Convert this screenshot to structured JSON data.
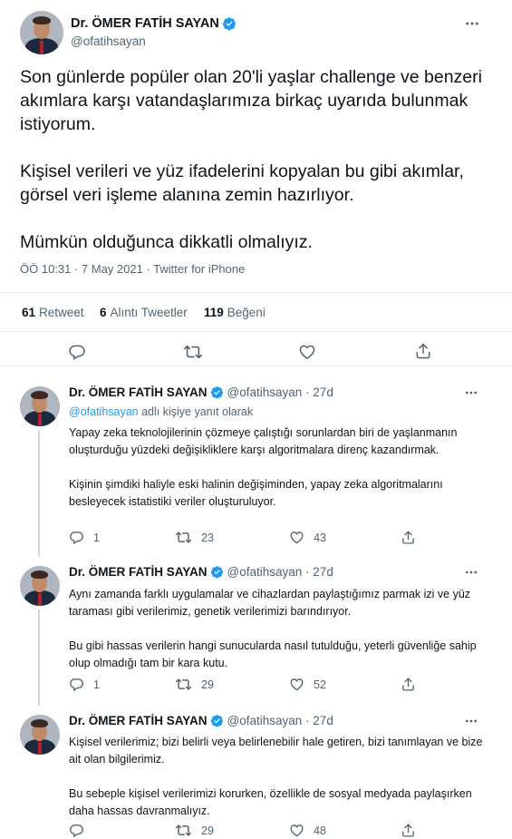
{
  "main_tweet": {
    "author_name": "Dr. ÖMER FATİH SAYAN",
    "author_handle": "@ofatihsayan",
    "paragraphs": [
      "Son günlerde popüler olan 20'li yaşlar challenge ve benzeri akımlara karşı vatandaşlarımıza birkaç uyarıda bulunmak istiyorum.",
      "Kişisel verileri ve yüz ifadelerini kopyalan bu gibi akımlar, görsel veri işleme alanına zemin hazırlıyor.",
      "Mümkün olduğunca dikkatli olmalıyız."
    ],
    "meta": "ÖÖ 10:31 · 7 May 2021 · Twitter for iPhone",
    "stats": {
      "retweets_count": "61",
      "retweets_label": "Retweet",
      "quotes_count": "6",
      "quotes_label": "Alıntı Tweetler",
      "likes_count": "119",
      "likes_label": "Beğeni"
    }
  },
  "replies": [
    {
      "author_name": "Dr. ÖMER FATİH SAYAN",
      "author_handle": "@ofatihsayan · 27d",
      "reply_to_link": "@ofatihsayan",
      "reply_to_suffix": " adlı kişiye yanıt olarak",
      "paragraphs": [
        "Yapay zeka teknolojilerinin çözmeye çalıştığı sorunlardan biri de yaşlanmanın oluşturduğu yüzdeki değişikliklere karşı algoritmalara direnç kazandırmak.",
        "Kişinin şimdiki haliyle eski halinin değişiminden, yapay zeka algoritmalarını besleyecek istatistiki veriler oluşturuluyor."
      ],
      "replies_count": "1",
      "retweets_count": "23",
      "likes_count": "43"
    },
    {
      "author_name": "Dr. ÖMER FATİH SAYAN",
      "author_handle": "@ofatihsayan · 27d",
      "paragraphs": [
        "Aynı zamanda farklı uygulamalar ve cihazlardan paylaştığımız parmak izi ve yüz taraması gibi verilerimiz, genetik verilerimizi barındırıyor.",
        "Bu gibi hassas verilerin hangi sunucularda nasıl tutulduğu, yeterli güvenliğe sahip olup olmadığı tam bir kara kutu."
      ],
      "replies_count": "1",
      "retweets_count": "29",
      "likes_count": "52"
    },
    {
      "author_name": "Dr. ÖMER FATİH SAYAN",
      "author_handle": "@ofatihsayan · 27d",
      "paragraphs": [
        "Kişisel verilerimiz; bizi belirli veya belirlenebilir hale getiren, bizi tanımlayan ve bize ait olan bilgilerimiz.",
        "Bu sebeple kişisel verilerimizi korurken, özellikle de sosyal medyada paylaşırken daha hassas davranmalıyız."
      ],
      "replies_count": "",
      "retweets_count": "29",
      "likes_count": "48"
    }
  ],
  "icons": {
    "verified": "verified-badge-icon",
    "more": "more-horizontal-icon",
    "reply": "reply-icon",
    "retweet": "retweet-icon",
    "like": "heart-icon",
    "share": "share-icon"
  },
  "colors": {
    "accent": "#1d9bf0",
    "text": "#0f1419",
    "secondary": "#536471",
    "divider": "#e6ecf0"
  }
}
